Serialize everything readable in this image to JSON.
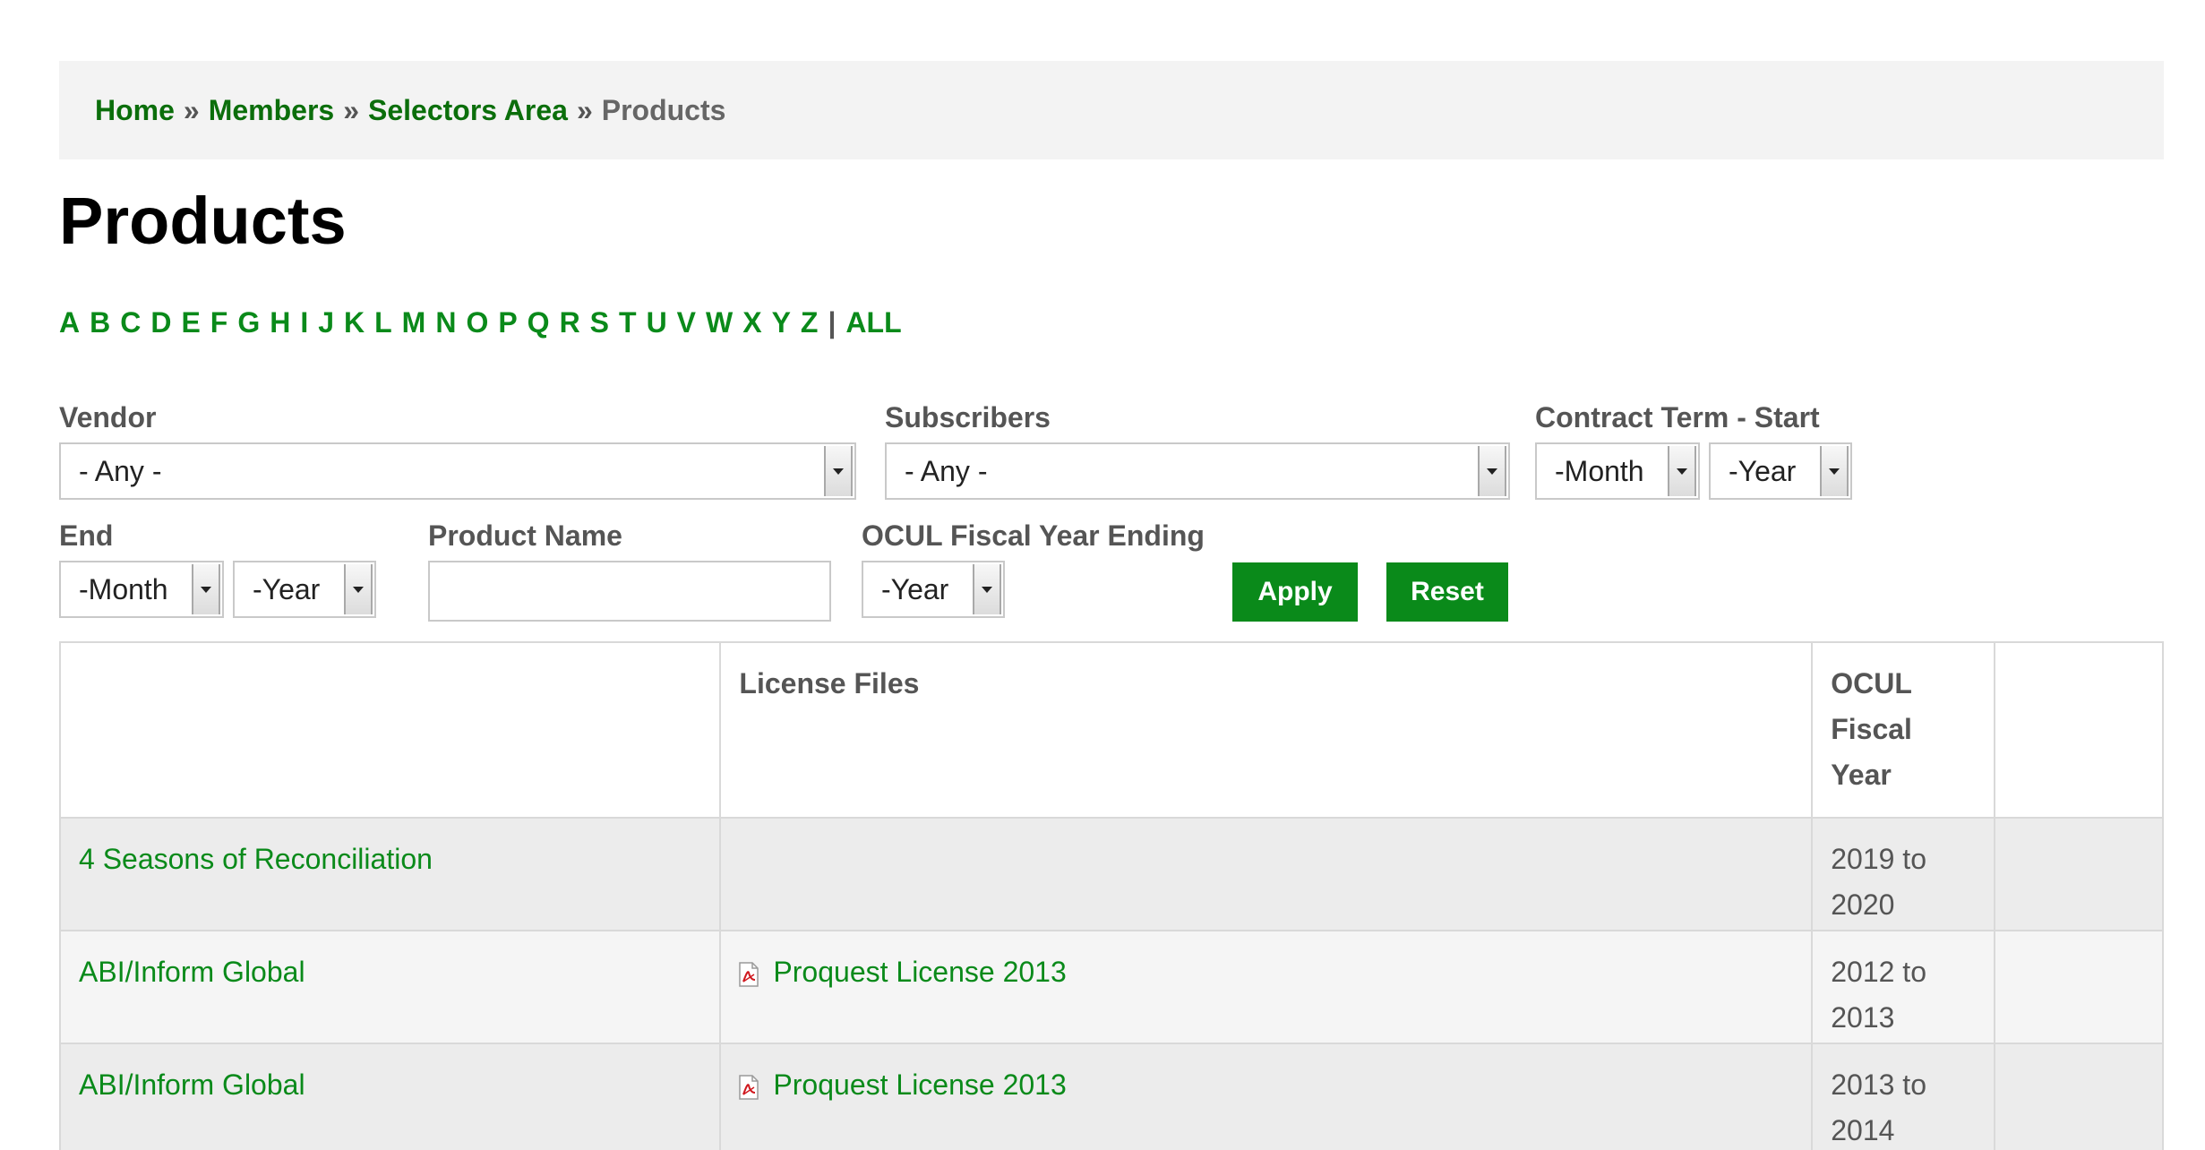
{
  "breadcrumb": {
    "items": [
      "Home",
      "Members",
      "Selectors Area"
    ],
    "separator": "»",
    "current": "Products"
  },
  "page_title": "Products",
  "alpha_pager": {
    "letters": [
      "A",
      "B",
      "C",
      "D",
      "E",
      "F",
      "G",
      "H",
      "I",
      "J",
      "K",
      "L",
      "M",
      "N",
      "O",
      "P",
      "Q",
      "R",
      "S",
      "T",
      "U",
      "V",
      "W",
      "X",
      "Y",
      "Z"
    ],
    "separator": "|",
    "all_label": "ALL"
  },
  "filters": {
    "vendor": {
      "label": "Vendor",
      "value": "- Any -"
    },
    "subscribers": {
      "label": "Subscribers",
      "value": "- Any -"
    },
    "contract_start": {
      "label": "Contract Term - Start",
      "month": "-Month",
      "year": "-Year"
    },
    "end": {
      "label": "End",
      "month": "-Month",
      "year": "-Year"
    },
    "product_name": {
      "label": "Product Name",
      "value": ""
    },
    "fiscal_year_ending": {
      "label": "OCUL Fiscal Year Ending",
      "value": "-Year"
    },
    "apply_label": "Apply",
    "reset_label": "Reset"
  },
  "table": {
    "headers": [
      "",
      "License Files",
      "OCUL Fiscal Year",
      ""
    ],
    "rows": [
      {
        "product": "4 Seasons of Reconciliation",
        "license": "",
        "fiscal": "2019 to 2020"
      },
      {
        "product": "ABI/Inform Global",
        "license": "Proquest License 2013",
        "fiscal": "2012 to 2013"
      },
      {
        "product": "ABI/Inform Global",
        "license": "Proquest License 2013",
        "fiscal": "2013 to 2014"
      }
    ]
  },
  "colors": {
    "link": "#0a8a1a",
    "breadcrumb_link": "#0b6e0b",
    "button": "#0a8a1a",
    "pdf_icon": "#d0181e"
  }
}
